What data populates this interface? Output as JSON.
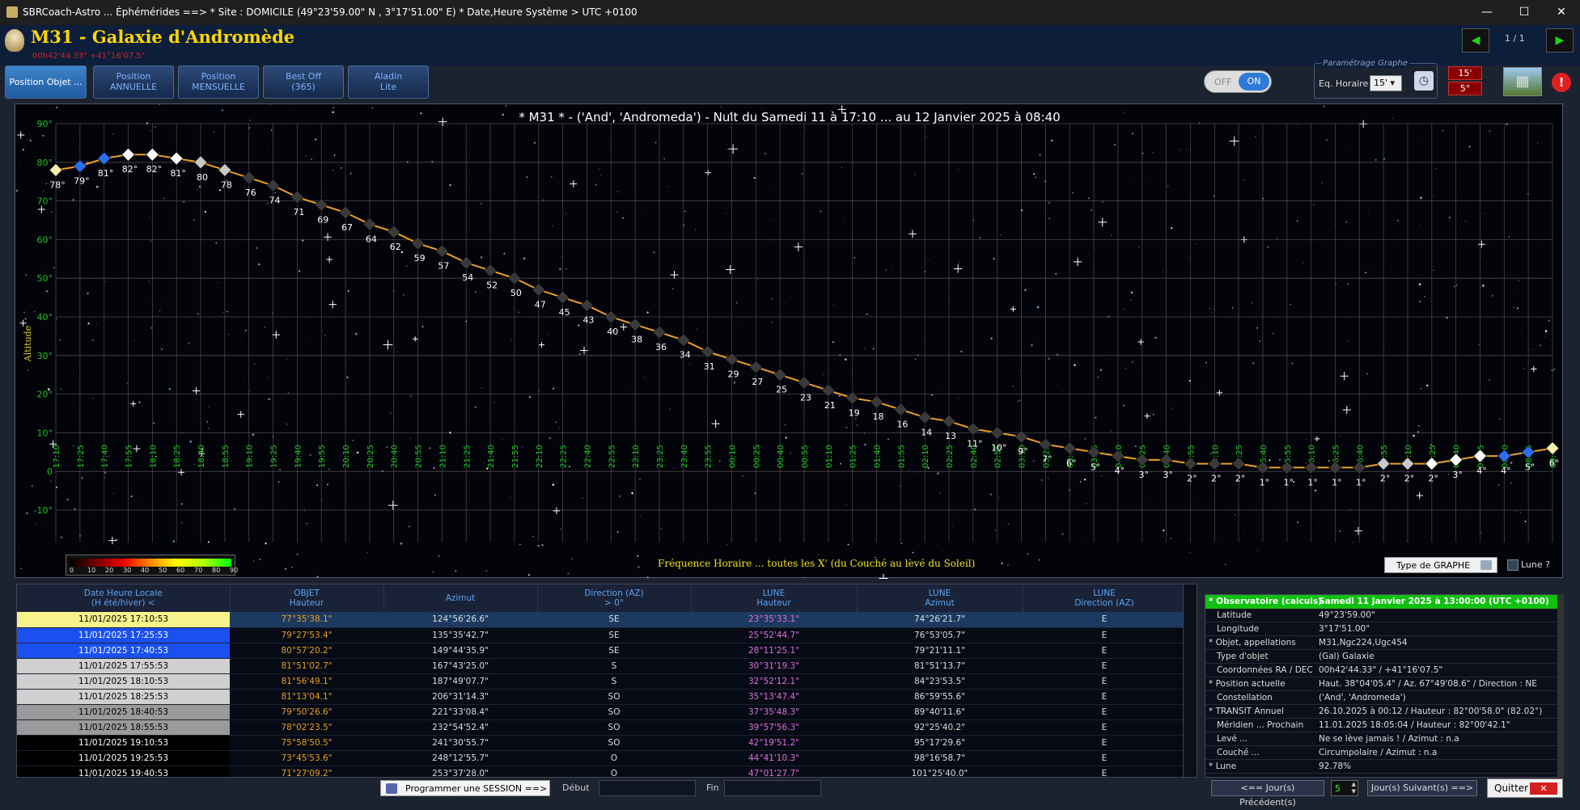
{
  "window": {
    "title": "SBRCoach-Astro ... Éphémérides  ==> * Site : DOMICILE (49°23'59.00\" N , 3°17'51.00\" E)  * Date,Heure Système > UTC +0100",
    "minimize": "—",
    "maximize": "☐",
    "close": "✕"
  },
  "header": {
    "object_title": "M31 - Galaxie d'Andromède",
    "coords": "00h42'44.33\"   +41°16'07.5\"",
    "page_indicator": "1 / 1",
    "prev": "◀",
    "next": "▶"
  },
  "tabs": [
    {
      "line1": "Position Objet ...",
      "line2": ""
    },
    {
      "line1": "Position",
      "line2": "ANNUELLE"
    },
    {
      "line1": "Position",
      "line2": "MENSUELLE"
    },
    {
      "line1": "Best Off",
      "line2": "(365)"
    },
    {
      "line1": "Aladin",
      "line2": "Lite"
    }
  ],
  "toggle": {
    "off": "OFF",
    "on": "ON"
  },
  "graph_params": {
    "group_label": "Paramétrage Graphe",
    "eq_label": "Eq. Horaire",
    "interval": "15'",
    "red_top": "15'",
    "red_bottom": "5°"
  },
  "chart_title": "* M31 * - ('And', 'Andromeda') - Nuit du Samedi 11 à 17:10 ... au 12 Janvier 2025 à 08:40",
  "chart_data": {
    "type": "line",
    "ylabel": "Altitude",
    "xlabel": "Fréquence Horaire ... toutes les X' (du Couché au levé du Soleil)",
    "ylim": [
      -10,
      90
    ],
    "yticks": [
      "90°",
      "80°",
      "70°",
      "60°",
      "50°",
      "40°",
      "30°",
      "20°",
      "10°",
      "0",
      "-10°"
    ],
    "grid": true,
    "x": [
      "17:10",
      "17:25",
      "17:40",
      "17:55",
      "18:10",
      "18:25",
      "18:40",
      "18:55",
      "19:10",
      "19:25",
      "19:40",
      "19:55",
      "20:10",
      "20:25",
      "20:40",
      "20:55",
      "21:10",
      "21:25",
      "21:40",
      "21:55",
      "22:10",
      "22:25",
      "22:40",
      "22:55",
      "23:10",
      "23:25",
      "23:40",
      "23:55",
      "00:10",
      "00:25",
      "00:40",
      "00:55",
      "01:10",
      "01:25",
      "01:40",
      "01:55",
      "02:10",
      "02:25",
      "02:40",
      "02:55",
      "03:10",
      "03:25",
      "03:40",
      "03:55",
      "04:10",
      "04:25",
      "04:40",
      "04:55",
      "05:10",
      "05:25",
      "05:40",
      "05:55",
      "06:10",
      "06:25",
      "06:40",
      "06:55",
      "07:10",
      "07:25",
      "07:40",
      "07:55",
      "08:10",
      "08:25",
      "08:40"
    ],
    "values": [
      78,
      79,
      81,
      82,
      82,
      81,
      80,
      78,
      76,
      74,
      71,
      69,
      67,
      64,
      62,
      59,
      57,
      54,
      52,
      50,
      47,
      45,
      43,
      40,
      38,
      36,
      34,
      31,
      29,
      27,
      25,
      23,
      21,
      19,
      18,
      16,
      14,
      13,
      11,
      10,
      9,
      7,
      6,
      5,
      4,
      3,
      3,
      2,
      2,
      2,
      1,
      1,
      1,
      1,
      1,
      2,
      2,
      2,
      3,
      4,
      4,
      5,
      6
    ],
    "labels": [
      "78°",
      "79°",
      "81°",
      "82°",
      "82°",
      "81°",
      "80",
      "78",
      "76",
      "74",
      "71",
      "69",
      "67",
      "64",
      "62",
      "59",
      "57",
      "54",
      "52",
      "50",
      "47",
      "45",
      "43",
      "40",
      "38",
      "36",
      "34",
      "31",
      "29",
      "27",
      "25",
      "23",
      "21",
      "19",
      "18",
      "16",
      "14",
      "13",
      "11°",
      "10°",
      "9°",
      "7°",
      "6°",
      "5°",
      "4°",
      "3°",
      "3°",
      "2°",
      "2°",
      "2°",
      "1°",
      "1°",
      "1°",
      "1°",
      "1°",
      "2°",
      "2°",
      "2°",
      "3°",
      "4°",
      "4°",
      "5°",
      "6°"
    ],
    "marker_colors": [
      "#f5f0b0",
      "#2a6ff0",
      "#2a6ff0",
      "#ffffff",
      "#ffffff",
      "#ffffff",
      "#c8c8c8",
      "#c8c8c8",
      "#3a3a3a",
      "#3a3a3a",
      "#3a3a3a",
      "#3a3a3a",
      "#3a3a3a",
      "#3a3a3a",
      "#3a3a3a",
      "#3a3a3a",
      "#3a3a3a",
      "#3a3a3a",
      "#3a3a3a",
      "#3a3a3a",
      "#3a3a3a",
      "#3a3a3a",
      "#3a3a3a",
      "#3a3a3a",
      "#3a3a3a",
      "#3a3a3a",
      "#3a3a3a",
      "#3a3a3a",
      "#3a3a3a",
      "#3a3a3a",
      "#3a3a3a",
      "#3a3a3a",
      "#3a3a3a",
      "#3a3a3a",
      "#3a3a3a",
      "#3a3a3a",
      "#3a3a3a",
      "#3a3a3a",
      "#3a3a3a",
      "#3a3a3a",
      "#3a3a3a",
      "#3a3a3a",
      "#3a3a3a",
      "#3a3a3a",
      "#3a3a3a",
      "#3a3a3a",
      "#3a3a3a",
      "#3a3a3a",
      "#3a3a3a",
      "#3a3a3a",
      "#3a3a3a",
      "#3a3a3a",
      "#3a3a3a",
      "#3a3a3a",
      "#3a3a3a",
      "#c8c8c8",
      "#c8c8c8",
      "#ffffff",
      "#ffffff",
      "#ffffff",
      "#2a6ff0",
      "#2a6ff0",
      "#f5f0b0"
    ],
    "line_color": "#f0a020",
    "scale_ticks": [
      "0",
      "10",
      "20",
      "30",
      "40",
      "50",
      "60",
      "70",
      "80",
      "90"
    ]
  },
  "chart_buttons": {
    "type_graph": "Type de GRAPHE",
    "moon": "Lune ?"
  },
  "table": {
    "headers": [
      {
        "l1": "Date Heure Locale",
        "l2": "(H été/hiver) <"
      },
      {
        "l1": "OBJET",
        "l2": "Hauteur"
      },
      {
        "l1": "Azimut",
        "l2": ""
      },
      {
        "l1": "Direction (AZ)",
        "l2": "> 0°"
      },
      {
        "l1": "LUNE",
        "l2": "Hauteur"
      },
      {
        "l1": "LUNE",
        "l2": "Azimut"
      },
      {
        "l1": "LUNE",
        "l2": "Direction (AZ)"
      }
    ],
    "rows": [
      {
        "dt": "11/01/2025 17:10:53",
        "oh": "77°35'38.1\"",
        "az": "124°56'26.6\"",
        "dir": "SE",
        "lh": "23°35'33.1\"",
        "la": "74°26'21.7\"",
        "ld": "E",
        "bg": "#f6f38a"
      },
      {
        "dt": "11/01/2025 17:25:53",
        "oh": "79°27'53.4\"",
        "az": "135°35'42.7\"",
        "dir": "SE",
        "lh": "25°52'44.7\"",
        "la": "76°53'05.7\"",
        "ld": "E",
        "bg": "#1a4ff0"
      },
      {
        "dt": "11/01/2025 17:40:53",
        "oh": "80°57'20.2\"",
        "az": "149°44'35.9\"",
        "dir": "SE",
        "lh": "28°11'25.1\"",
        "la": "79°21'11.1\"",
        "ld": "E",
        "bg": "#1a4ff0"
      },
      {
        "dt": "11/01/2025 17:55:53",
        "oh": "81°51'02.7\"",
        "az": "167°43'25.0\"",
        "dir": "S",
        "lh": "30°31'19.3\"",
        "la": "81°51'13.7\"",
        "ld": "E",
        "bg": "#d0d0d0"
      },
      {
        "dt": "11/01/2025 18:10:53",
        "oh": "81°56'49.1\"",
        "az": "187°49'07.7\"",
        "dir": "S",
        "lh": "32°52'12.1\"",
        "la": "84°23'53.5\"",
        "ld": "E",
        "bg": "#d0d0d0"
      },
      {
        "dt": "11/01/2025 18:25:53",
        "oh": "81°13'04.1\"",
        "az": "206°31'14.3\"",
        "dir": "SO",
        "lh": "35°13'47.4\"",
        "la": "86°59'55.6\"",
        "ld": "E",
        "bg": "#d0d0d0"
      },
      {
        "dt": "11/01/2025 18:40:53",
        "oh": "79°50'26.6\"",
        "az": "221°33'08.4\"",
        "dir": "SO",
        "lh": "37°35'48.3\"",
        "la": "89°40'11.6\"",
        "ld": "E",
        "bg": "#9a9a9a"
      },
      {
        "dt": "11/01/2025 18:55:53",
        "oh": "78°02'23.5\"",
        "az": "232°54'52.4\"",
        "dir": "SO",
        "lh": "39°57'56.3\"",
        "la": "92°25'40.2\"",
        "ld": "E",
        "bg": "#9a9a9a"
      },
      {
        "dt": "11/01/2025 19:10:53",
        "oh": "75°58'50.5\"",
        "az": "241°30'55.7\"",
        "dir": "SO",
        "lh": "42°19'51.2\"",
        "la": "95°17'29.6\"",
        "ld": "E",
        "bg": "#000000"
      },
      {
        "dt": "11/01/2025 19:25:53",
        "oh": "73°45'53.6\"",
        "az": "248°12'55.7\"",
        "dir": "O",
        "lh": "44°41'10.3\"",
        "la": "98°16'58.7\"",
        "ld": "E",
        "bg": "#000000"
      },
      {
        "dt": "11/01/2025 19:40:53",
        "oh": "71°27'09.2\"",
        "az": "253°37'28.0\"",
        "dir": "O",
        "lh": "47°01'27.7\"",
        "la": "101°25'40.0\"",
        "ld": "E",
        "bg": "#000000"
      }
    ]
  },
  "info": {
    "header_k": "* Observatoire (calculs)",
    "header_v": "Samedi 11 Janvier 2025 à 13:00:00   (UTC +0100)",
    "rows": [
      {
        "k": "Latitude",
        "v": "49°23'59.00\"",
        "sub": true
      },
      {
        "k": "Longitude",
        "v": "3°17'51.00\"",
        "sub": true
      },
      {
        "k": "* Objet, appellations",
        "v": "M31,Ngc224,Ugc454",
        "sub": false
      },
      {
        "k": "Type d'objet",
        "v": "(Gal) Galaxie",
        "sub": true
      },
      {
        "k": "Coordonnées RA / DEC",
        "v": "00h42'44.33\" / +41°16'07.5\"",
        "sub": true
      },
      {
        "k": "* Position actuelle",
        "v": "Haut. 38°04'05.4\" / Az. 67°49'08.6\" / Direction : NE",
        "sub": false
      },
      {
        "k": "Constellation",
        "v": "('And', 'Andromeda')",
        "sub": true
      },
      {
        "k": "* TRANSIT Annuel",
        "v": "26.10.2025 à 00:12 / Hauteur : 82°00'58.0\" (82.02°)",
        "sub": false
      },
      {
        "k": "Méridien ... Prochain",
        "v": "11.01.2025 18:05:04 / Hauteur : 82°00'42.1\"",
        "sub": true
      },
      {
        "k": "Levé ...",
        "v": "Ne se lève jamais ! / Azimut : n.a",
        "sub": true
      },
      {
        "k": "Couché ...",
        "v": "Circumpolaire / Azimut : n.a",
        "sub": true
      },
      {
        "k": "* Lune",
        "v": "92.78%",
        "sub": false
      }
    ]
  },
  "bottom": {
    "program": "Programmer une SESSION ==>",
    "debut": "Début",
    "fin": "Fin",
    "prev_day": "<== Jour(s) Précédent(s)",
    "days": "5",
    "next_day": "Jour(s) Suivant(s) ==>",
    "quit": "Quitter",
    "quit_x": "✕"
  }
}
